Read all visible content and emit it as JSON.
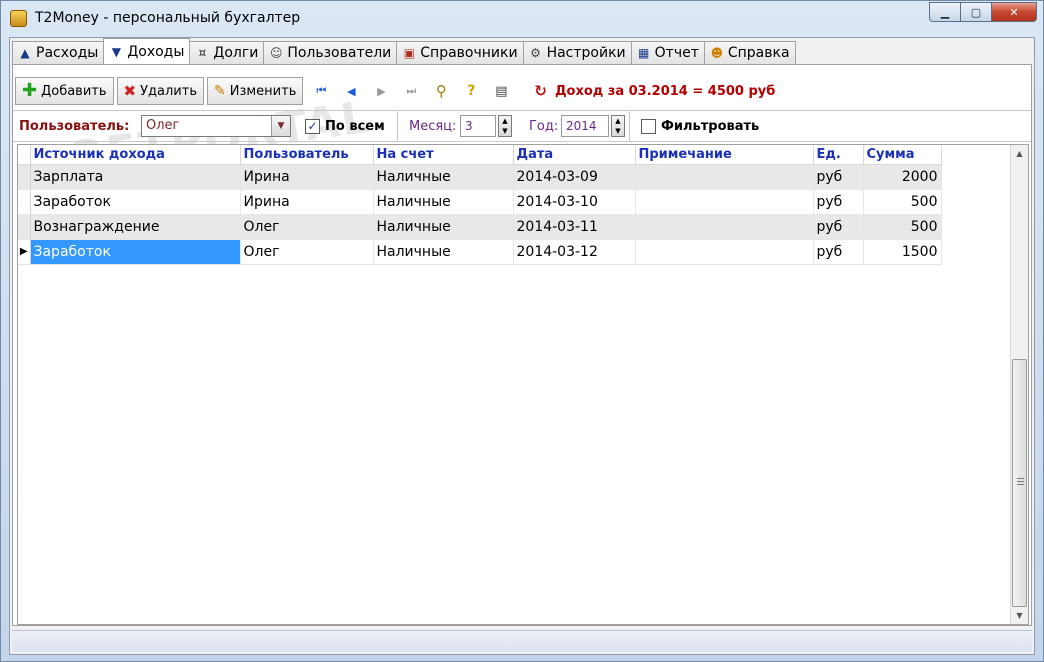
{
  "window": {
    "title": "T2Money - персональный бухгалтер",
    "controls": {
      "minimize": "▁",
      "maximize": "▢",
      "close": "✕"
    }
  },
  "tabs": [
    {
      "label": "Расходы",
      "icon": "triangle-up-icon",
      "glyph": "▲",
      "color": "#1a3b8a"
    },
    {
      "label": "Доходы",
      "icon": "triangle-down-icon",
      "glyph": "▼",
      "color": "#1a3b8a"
    },
    {
      "label": "Долги",
      "icon": "coins-icon",
      "glyph": "¤",
      "color": "#555555"
    },
    {
      "label": "Пользователи",
      "icon": "users-icon",
      "glyph": "☺",
      "color": "#444444"
    },
    {
      "label": "Справочники",
      "icon": "book-icon",
      "glyph": "▣",
      "color": "#b03020"
    },
    {
      "label": "Настройки",
      "icon": "settings-icon",
      "glyph": "⚙",
      "color": "#444444"
    },
    {
      "label": "Отчет",
      "icon": "report-icon",
      "glyph": "▦",
      "color": "#1a3b8a"
    },
    {
      "label": "Справка",
      "icon": "help-icon",
      "glyph": "☻",
      "color": "#d08000"
    }
  ],
  "active_tab": "Доходы",
  "toolbar": {
    "add_label": "Добавить",
    "delete_label": "Удалить",
    "edit_label": "Изменить",
    "summary": "Доход за 03.2014 = 4500 руб"
  },
  "filter": {
    "user_label": "Пользователь:",
    "user_value": "Олег",
    "all_label": "По всем",
    "all_checked": true,
    "month_label": "Месяц:",
    "month_value": "3",
    "year_label": "Год:",
    "year_value": "2014",
    "filter_label": "Фильтровать",
    "filter_checked": false
  },
  "grid": {
    "columns": [
      "Источник дохода",
      "Пользователь",
      "На счет",
      "Дата",
      "Примечание",
      "Ед.",
      "Сумма"
    ],
    "rows": [
      [
        "Зарплата",
        "Ирина",
        "Наличные",
        "2014-03-09",
        "",
        "руб",
        "2000"
      ],
      [
        "Заработок",
        "Ирина",
        "Наличные",
        "2014-03-10",
        "",
        "руб",
        "500"
      ],
      [
        "Вознаграждение",
        "Олег",
        "Наличные",
        "2014-03-11",
        "",
        "руб",
        "500"
      ],
      [
        "Заработок",
        "Олег",
        "Наличные",
        "2014-03-12",
        "",
        "руб",
        "1500"
      ]
    ],
    "selected_row": 3
  },
  "watermark": "SOFTPORTAL"
}
